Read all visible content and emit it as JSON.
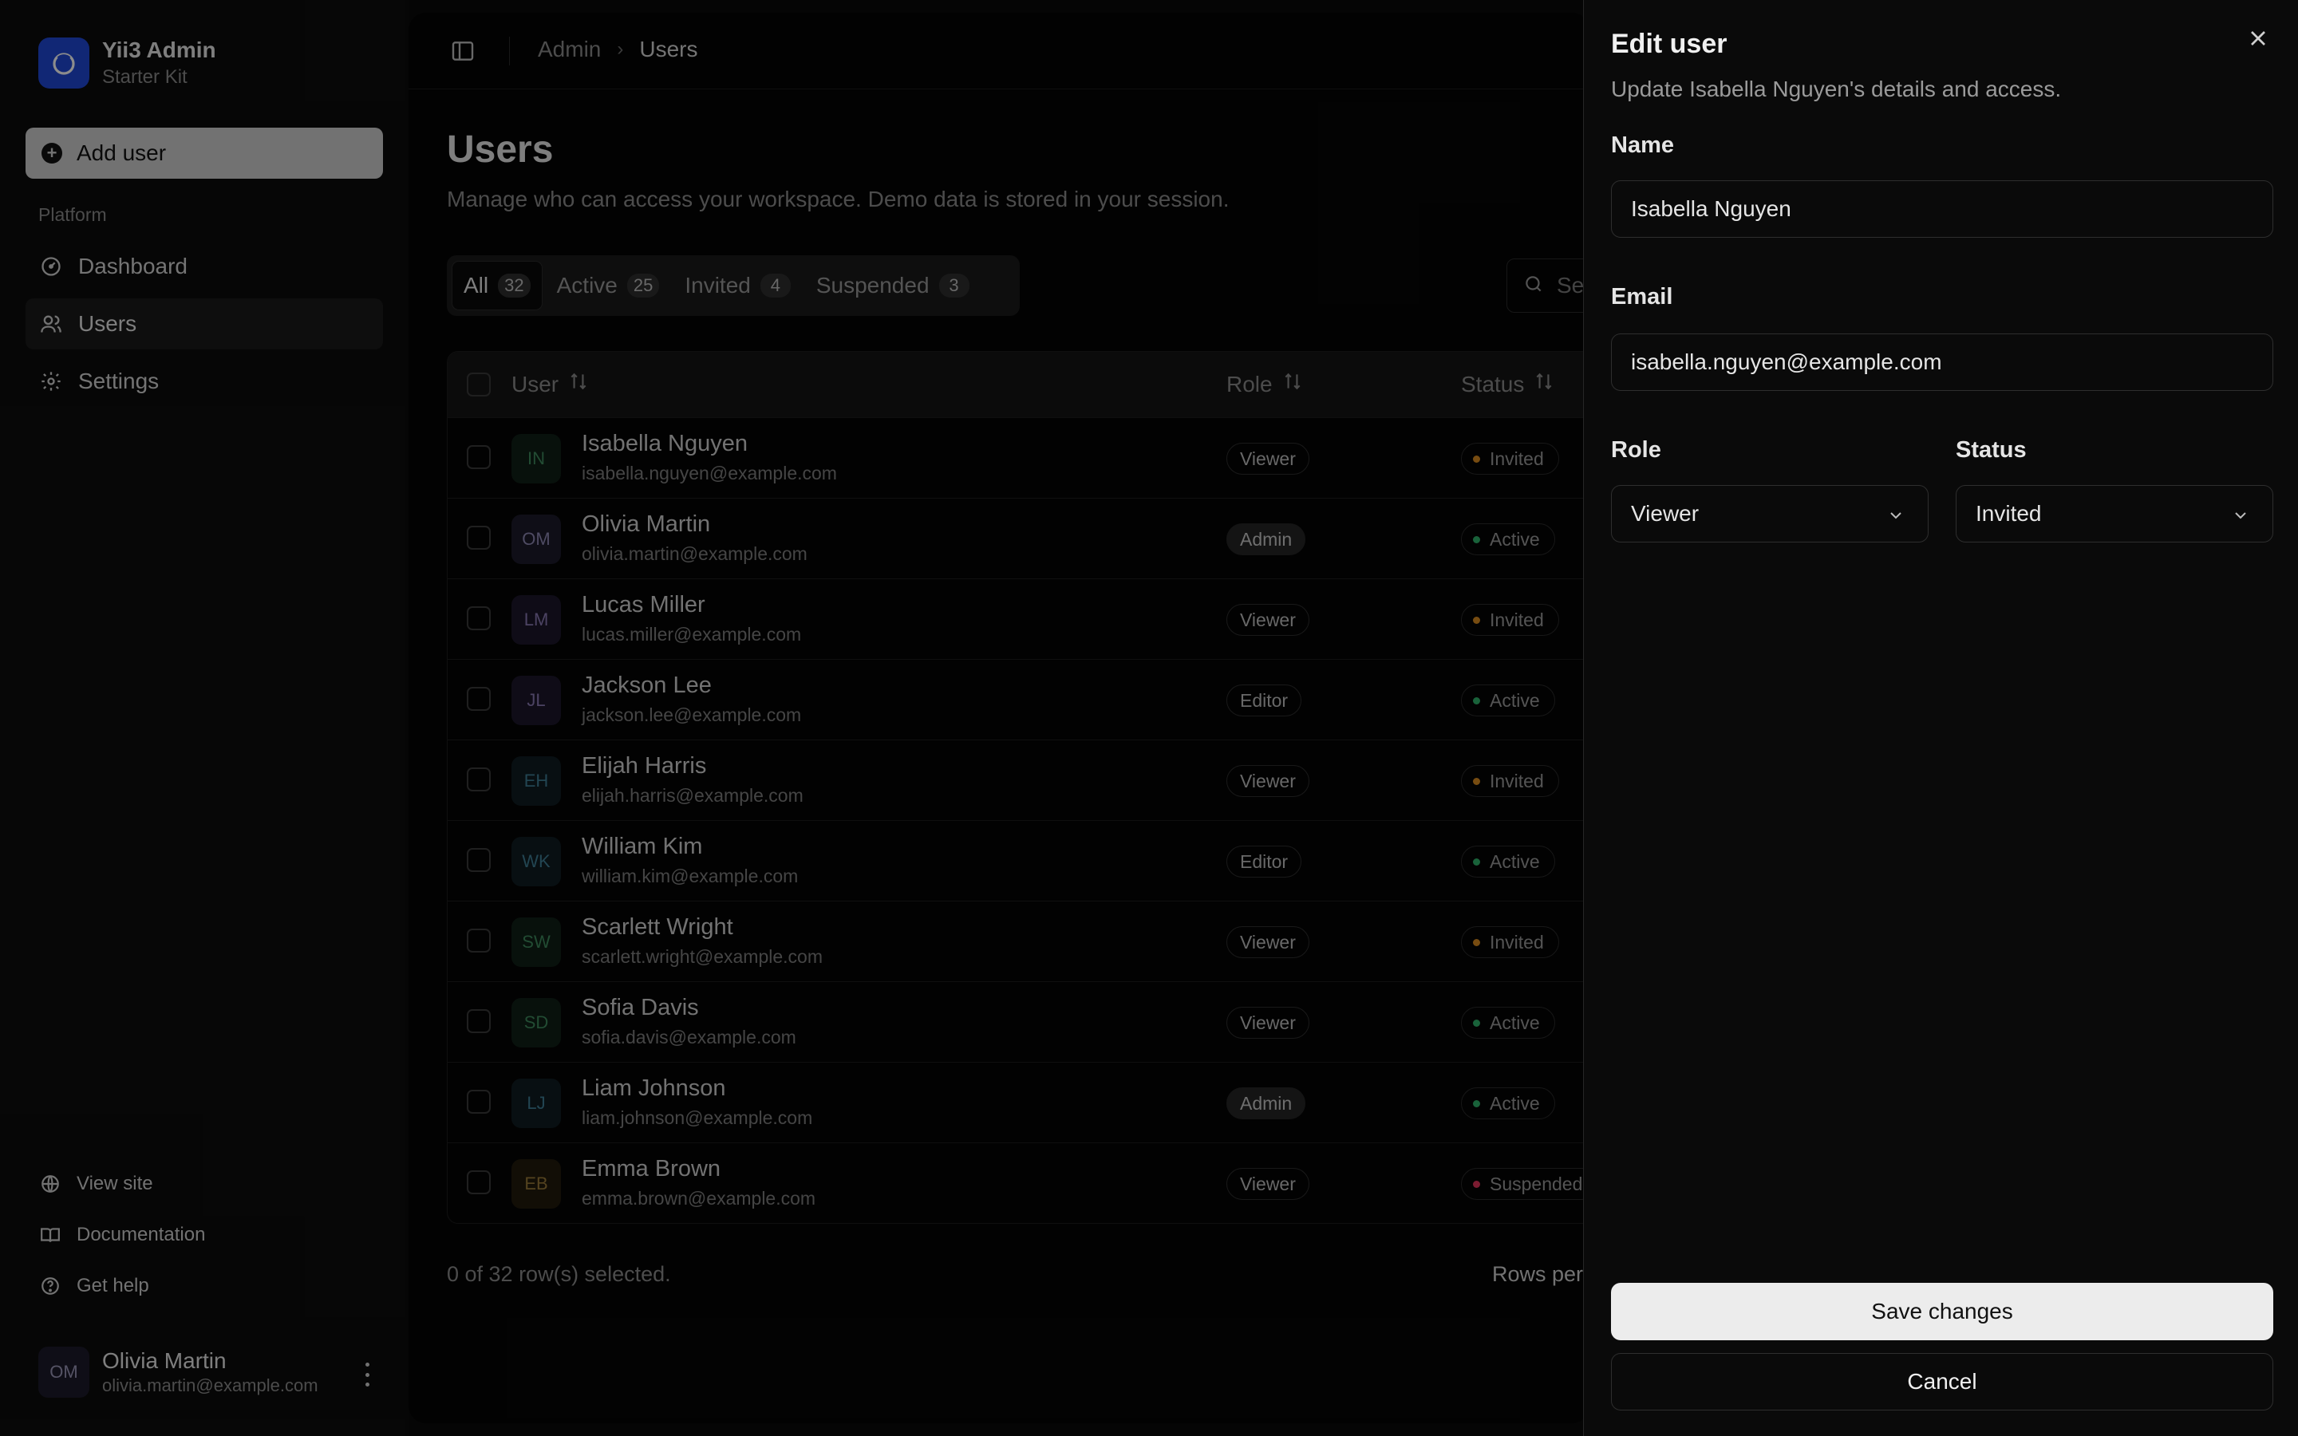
{
  "brand": {
    "title": "Yii3 Admin",
    "subtitle": "Starter Kit"
  },
  "sidebar": {
    "add_user_label": "Add user",
    "section_label": "Platform",
    "items": [
      {
        "label": "Dashboard",
        "icon": "dashboard-icon"
      },
      {
        "label": "Users",
        "icon": "users-icon",
        "active": true
      },
      {
        "label": "Settings",
        "icon": "gear-icon"
      }
    ],
    "footer": [
      {
        "label": "View site",
        "icon": "globe-icon"
      },
      {
        "label": "Documentation",
        "icon": "book-icon"
      },
      {
        "label": "Get help",
        "icon": "help-icon"
      }
    ],
    "profile": {
      "initials": "OM",
      "name": "Olivia Martin",
      "email": "olivia.martin@example.com"
    }
  },
  "breadcrumb": {
    "parent": "Admin",
    "separator": "›",
    "current": "Users"
  },
  "page": {
    "title": "Users",
    "description": "Manage who can access your workspace. Demo data is stored in your session."
  },
  "tabs": [
    {
      "label": "All",
      "count": "32",
      "active": true
    },
    {
      "label": "Active",
      "count": "25"
    },
    {
      "label": "Invited",
      "count": "4"
    },
    {
      "label": "Suspended",
      "count": "3"
    }
  ],
  "search": {
    "placeholder": "Search users..."
  },
  "table": {
    "columns": {
      "user": "User",
      "role": "Role",
      "status": "Status"
    },
    "rows": [
      {
        "initials": "IN",
        "name": "Isabella Nguyen",
        "email": "isabella.nguyen@example.com",
        "role": "Viewer",
        "status": "Invited",
        "avatar_bg": "#0f1f17",
        "avatar_fg": "#3f8a5e"
      },
      {
        "initials": "OM",
        "name": "Olivia Martin",
        "email": "olivia.martin@example.com",
        "role": "Admin",
        "status": "Active",
        "avatar_bg": "#1c1a2a",
        "avatar_fg": "#8f89b4"
      },
      {
        "initials": "LM",
        "name": "Lucas Miller",
        "email": "lucas.miller@example.com",
        "role": "Viewer",
        "status": "Invited",
        "avatar_bg": "#1c172a",
        "avatar_fg": "#8a7bb4"
      },
      {
        "initials": "JL",
        "name": "Jackson Lee",
        "email": "jackson.lee@example.com",
        "role": "Editor",
        "status": "Active",
        "avatar_bg": "#1c172a",
        "avatar_fg": "#8a7bb4"
      },
      {
        "initials": "EH",
        "name": "Elijah Harris",
        "email": "elijah.harris@example.com",
        "role": "Viewer",
        "status": "Invited",
        "avatar_bg": "#0f1c22",
        "avatar_fg": "#3f7f96"
      },
      {
        "initials": "WK",
        "name": "William Kim",
        "email": "william.kim@example.com",
        "role": "Editor",
        "status": "Active",
        "avatar_bg": "#0f1c22",
        "avatar_fg": "#3f7f96"
      },
      {
        "initials": "SW",
        "name": "Scarlett Wright",
        "email": "scarlett.wright@example.com",
        "role": "Viewer",
        "status": "Invited",
        "avatar_bg": "#0f1f17",
        "avatar_fg": "#3f8a5e"
      },
      {
        "initials": "SD",
        "name": "Sofia Davis",
        "email": "sofia.davis@example.com",
        "role": "Viewer",
        "status": "Active",
        "avatar_bg": "#0f1f17",
        "avatar_fg": "#3f8a5e"
      },
      {
        "initials": "LJ",
        "name": "Liam Johnson",
        "email": "liam.johnson@example.com",
        "role": "Admin",
        "status": "Active",
        "avatar_bg": "#0f1c22",
        "avatar_fg": "#3f7f96"
      },
      {
        "initials": "EB",
        "name": "Emma Brown",
        "email": "emma.brown@example.com",
        "role": "Viewer",
        "status": "Suspended",
        "avatar_bg": "#221a0c",
        "avatar_fg": "#9a7a3a"
      }
    ],
    "selection_text": "0 of 32 row(s) selected.",
    "rows_per_page_label": "Rows per page"
  },
  "status_colors": {
    "Invited": "#d98a1f",
    "Active": "#2fb36a",
    "Suspended": "#e0345a"
  },
  "sheet": {
    "title": "Edit user",
    "description": "Update Isabella Nguyen's details and access.",
    "name_label": "Name",
    "name_value": "Isabella Nguyen",
    "email_label": "Email",
    "email_value": "isabella.nguyen@example.com",
    "role_label": "Role",
    "role_value": "Viewer",
    "status_label": "Status",
    "status_value": "Invited",
    "save_label": "Save changes",
    "cancel_label": "Cancel"
  }
}
